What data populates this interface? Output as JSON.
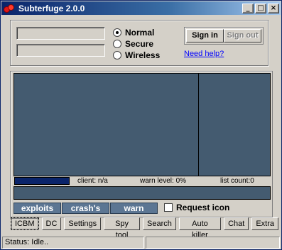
{
  "window": {
    "title": "Subterfuge 2.0.0",
    "controls": {
      "minimize": "_",
      "maximize": "□",
      "close": "×"
    }
  },
  "login": {
    "username_value": "",
    "password_value": "",
    "modes": [
      {
        "label": "Normal",
        "checked": true
      },
      {
        "label": "Secure",
        "checked": false
      },
      {
        "label": "Wireless",
        "checked": false
      }
    ],
    "sign_in_label": "Sign in",
    "sign_out_label": "Sign out",
    "help_link": "Need help?"
  },
  "status_strip": {
    "client": "client: n/a",
    "warn_level": "warn level: 0%",
    "list_count": "list count:0"
  },
  "actions": {
    "exploits": "exploits",
    "crashes": "crash's",
    "warn": "warn",
    "request_icon": "Request icon"
  },
  "tabs": [
    {
      "label": "ICBM",
      "active": true
    },
    {
      "label": "DC",
      "active": false
    },
    {
      "label": "Settings",
      "active": false
    },
    {
      "label": "Spy tool",
      "active": false
    },
    {
      "label": "Search",
      "active": false
    },
    {
      "label": "Auto killer",
      "active": false
    },
    {
      "label": "Chat",
      "active": false
    },
    {
      "label": "Extra",
      "active": false
    }
  ],
  "statusbar": {
    "status": "Status: Idle..",
    "secondary": ""
  },
  "colors": {
    "display_bg": "#445b70",
    "button_bg": "#5c7693",
    "title_start": "#0a246a",
    "progress": "#0a246a"
  }
}
